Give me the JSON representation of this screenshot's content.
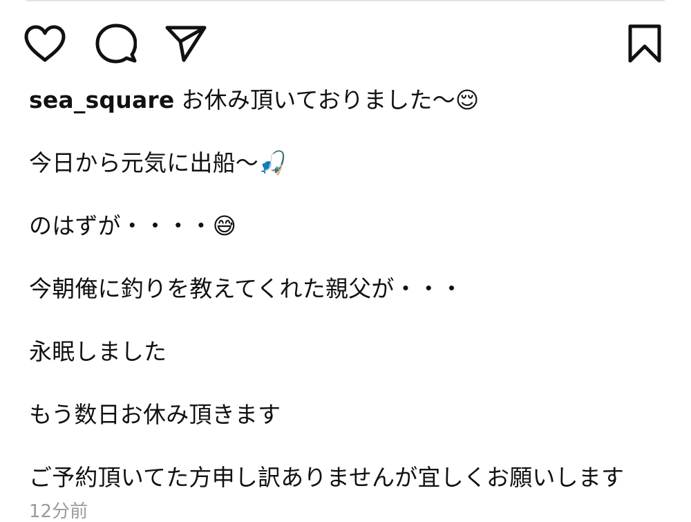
{
  "post": {
    "username": "sea_square",
    "caption_first": "お休み頂いておりました〜😌",
    "caption_lines": [
      "今日から元気に出船〜🎣",
      "のはずが・・・・😅",
      "今朝俺に釣りを教えてくれた親父が・・・",
      "永眠しました",
      "もう数日お休み頂きます",
      "ご予約頂いてた方申し訳ありませんが宜しくお願いします"
    ],
    "timestamp": "12分前"
  },
  "icons": {
    "like": "heart-icon",
    "comment": "comment-bubble-icon",
    "share": "paper-plane-icon",
    "save": "bookmark-icon"
  },
  "colors": {
    "text": "#111111",
    "icon": "#111111",
    "secondary": "#9a9a9a",
    "divider": "#e3e3e3",
    "background": "#ffffff"
  }
}
